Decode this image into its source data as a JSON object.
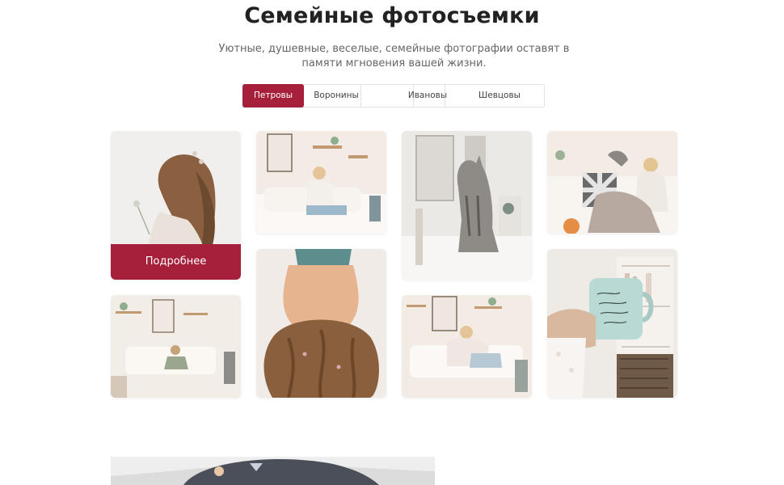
{
  "header": {
    "title": "Семейные фотосъемки",
    "subtitle": "Уютные, душевные, веселые, семейные фотографии оставят в памяти мгновения вашей жизни."
  },
  "tabs": [
    {
      "label": "Петровы",
      "active": true
    },
    {
      "label": "Воронины",
      "active": false
    },
    {
      "label": "",
      "active": false
    },
    {
      "label": "Ивановы",
      "active": false
    },
    {
      "label": "Шевцовы",
      "active": false
    }
  ],
  "gallery": {
    "more_button_label": "Подробнее",
    "photos": [
      {
        "name": "girl-hair-flowers"
      },
      {
        "name": "woman-on-couch-reading"
      },
      {
        "name": "cat-on-shelf"
      },
      {
        "name": "woman-with-cat-reading"
      },
      {
        "name": "girl-in-room"
      },
      {
        "name": "girl-lying-hair"
      },
      {
        "name": "mother-daughter-couch"
      },
      {
        "name": "hand-holding-mug"
      }
    ]
  },
  "colors": {
    "accent": "#a6203b",
    "text": "#222222",
    "muted": "#666666",
    "border": "#e2e2e2"
  }
}
